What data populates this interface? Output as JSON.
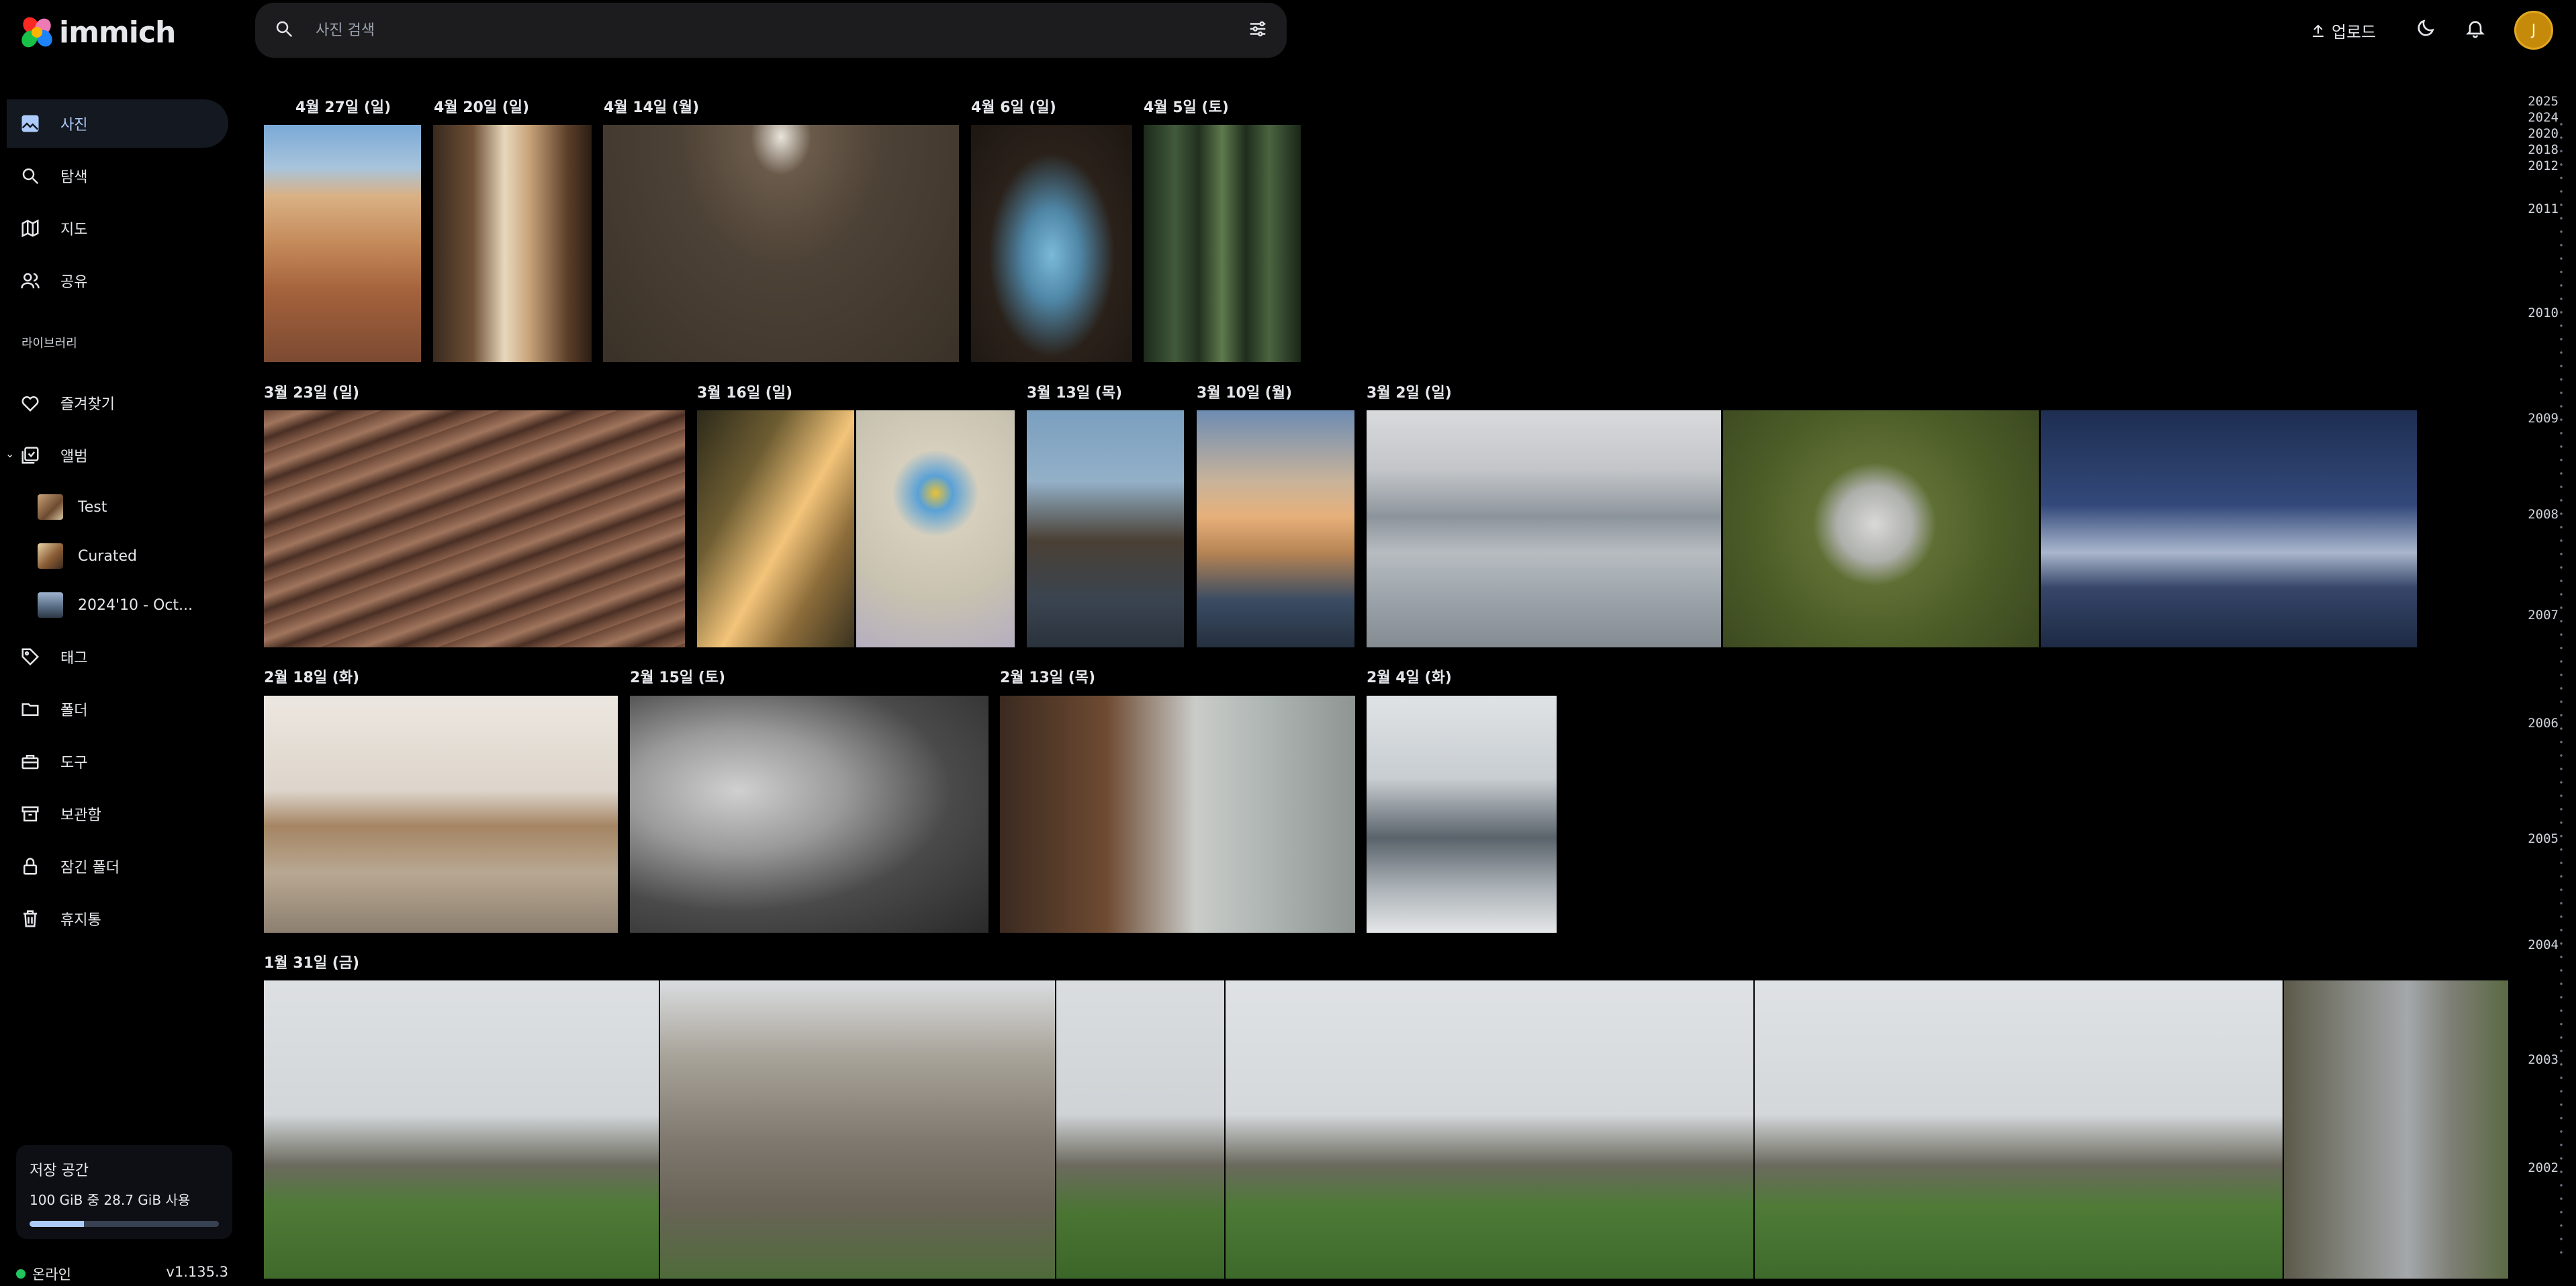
{
  "app": {
    "name": "immich",
    "version": "v1.135.3"
  },
  "search": {
    "placeholder": "사진 검색"
  },
  "header": {
    "upload_label": "업로드",
    "avatar_initial": "J"
  },
  "sidebar": {
    "items": [
      {
        "label": "사진",
        "icon": "photos-icon"
      },
      {
        "label": "탐색",
        "icon": "search-icon"
      },
      {
        "label": "지도",
        "icon": "map-icon"
      },
      {
        "label": "공유",
        "icon": "people-icon"
      }
    ],
    "library_label": "라이브러리",
    "library_items": [
      {
        "label": "즐겨찾기",
        "icon": "heart-icon"
      },
      {
        "label": "앨범",
        "icon": "album-icon"
      }
    ],
    "albums": [
      {
        "label": "Test"
      },
      {
        "label": "Curated"
      },
      {
        "label": "2024'10 - Oct..."
      }
    ],
    "more_items": [
      {
        "label": "태그",
        "icon": "tag-icon"
      },
      {
        "label": "폴더",
        "icon": "folder-icon"
      },
      {
        "label": "도구",
        "icon": "toolbox-icon"
      },
      {
        "label": "보관함",
        "icon": "archive-icon"
      },
      {
        "label": "잠긴 폴더",
        "icon": "lock-icon"
      },
      {
        "label": "휴지통",
        "icon": "trash-icon"
      }
    ]
  },
  "storage": {
    "title": "저장 공간",
    "usage": "100 GiB 중 28.7 GiB 사용",
    "fraction": 0.287
  },
  "status": {
    "online_label": "온라인"
  },
  "timeline": {
    "groups": [
      {
        "date": "4월 27일 (일)"
      },
      {
        "date": "4월 20일 (일)"
      },
      {
        "date": "4월 14일 (월)"
      },
      {
        "date": "4월 6일 (일)"
      },
      {
        "date": "4월 5일 (토)"
      },
      {
        "date": "3월 23일 (일)"
      },
      {
        "date": "3월 16일 (일)"
      },
      {
        "date": "3월 13일 (목)"
      },
      {
        "date": "3월 10일 (월)"
      },
      {
        "date": "3월 2일 (일)"
      },
      {
        "date": "2월 18일 (화)"
      },
      {
        "date": "2월 15일 (토)"
      },
      {
        "date": "2월 13일 (목)"
      },
      {
        "date": "2월 4일 (화)"
      },
      {
        "date": "1월 31일 (금)"
      }
    ]
  },
  "scrubber": {
    "years": [
      "2025",
      "2024",
      "2020",
      "2018",
      "2012",
      "2011",
      "2010",
      "2009",
      "2008",
      "2007",
      "2006",
      "2005",
      "2004",
      "2003",
      "2002"
    ]
  }
}
